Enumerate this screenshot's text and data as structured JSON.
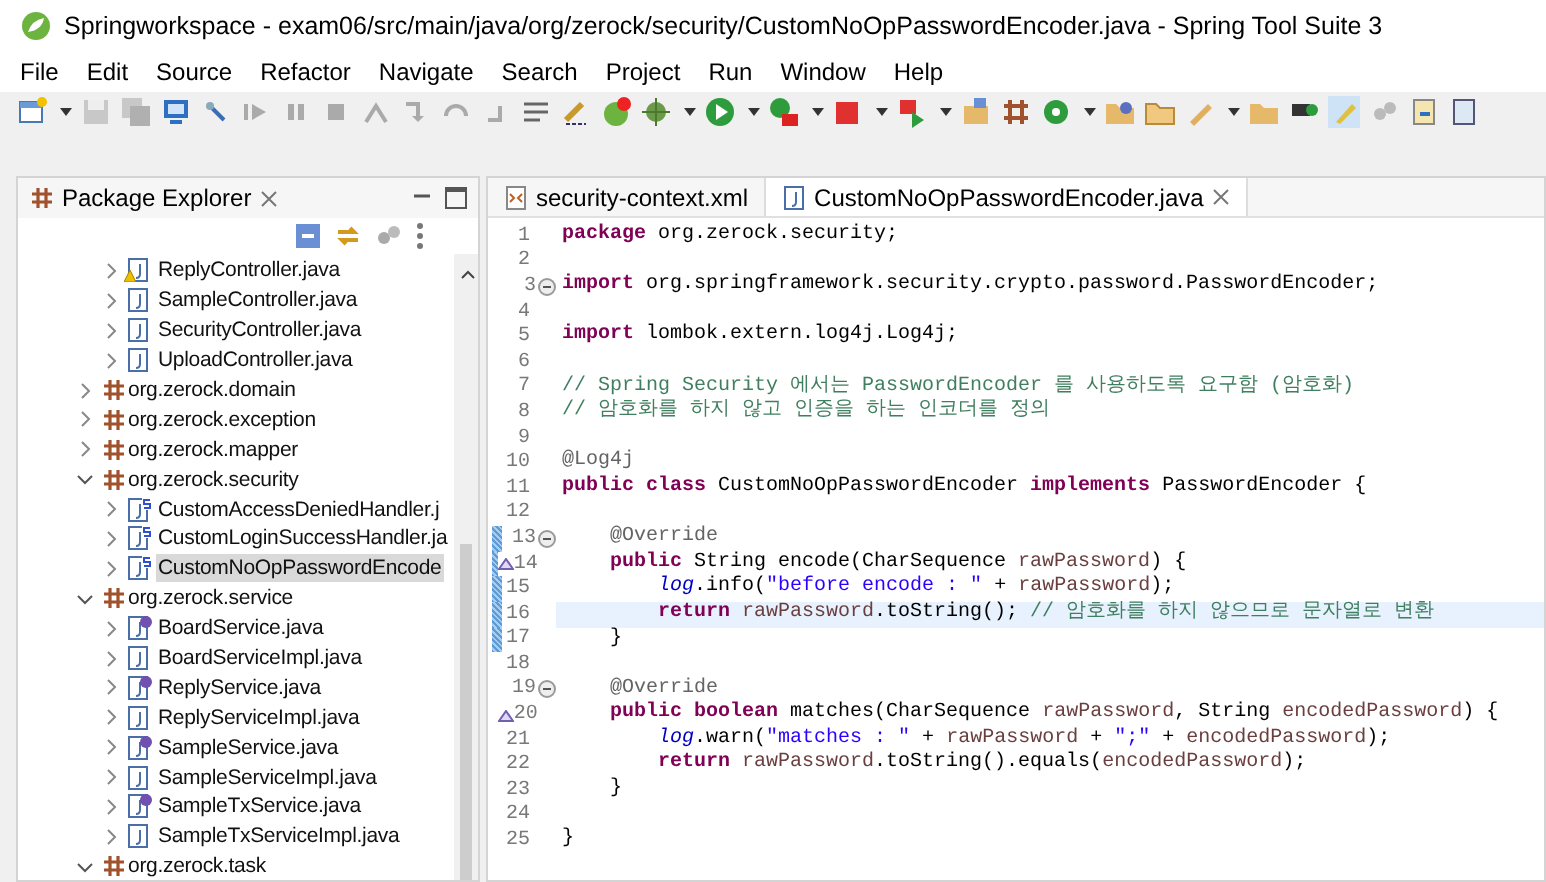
{
  "window": {
    "title": "Springworkspace - exam06/src/main/java/org/zerock/security/CustomNoOpPasswordEncoder.java - Spring Tool Suite 3"
  },
  "menu": [
    "File",
    "Edit",
    "Source",
    "Refactor",
    "Navigate",
    "Search",
    "Project",
    "Run",
    "Window",
    "Help"
  ],
  "explorer": {
    "title": "Package Explorer",
    "continued_files": [
      {
        "label": "ReplyController.java",
        "kind": "warning",
        "selected": false
      },
      {
        "label": "SampleController.java",
        "kind": "class",
        "selected": false
      },
      {
        "label": "SecurityController.java",
        "kind": "class",
        "selected": false
      },
      {
        "label": "UploadController.java",
        "kind": "class",
        "selected": false
      }
    ],
    "packages": [
      {
        "label": "org.zerock.domain",
        "expanded": false
      },
      {
        "label": "org.zerock.exception",
        "expanded": false
      },
      {
        "label": "org.zerock.mapper",
        "expanded": false
      },
      {
        "label": "org.zerock.security",
        "expanded": true,
        "children": [
          {
            "label": "CustomAccessDeniedHandler.j",
            "kind": "bean",
            "selected": false
          },
          {
            "label": "CustomLoginSuccessHandler.ja",
            "kind": "bean",
            "selected": false
          },
          {
            "label": "CustomNoOpPasswordEncode",
            "kind": "bean",
            "selected": true
          }
        ]
      },
      {
        "label": "org.zerock.service",
        "expanded": true,
        "children": [
          {
            "label": "BoardService.java",
            "kind": "interface",
            "selected": false
          },
          {
            "label": "BoardServiceImpl.java",
            "kind": "class",
            "selected": false
          },
          {
            "label": "ReplyService.java",
            "kind": "interface",
            "selected": false
          },
          {
            "label": "ReplyServiceImpl.java",
            "kind": "class",
            "selected": false
          },
          {
            "label": "SampleService.java",
            "kind": "interface",
            "selected": false
          },
          {
            "label": "SampleServiceImpl.java",
            "kind": "class",
            "selected": false
          },
          {
            "label": "SampleTxService.java",
            "kind": "interface",
            "selected": false
          },
          {
            "label": "SampleTxServiceImpl.java",
            "kind": "class",
            "selected": false
          }
        ]
      },
      {
        "label": "org.zerock.task",
        "expanded": true
      }
    ]
  },
  "editor": {
    "tabs": [
      {
        "label": "security-context.xml",
        "kind": "xml",
        "selected": false
      },
      {
        "label": "CustomNoOpPasswordEncoder.java",
        "kind": "java",
        "selected": true
      }
    ],
    "lines": [
      {
        "number": "1",
        "kind": "plain",
        "changed": false,
        "current": false,
        "tokens": [
          {
            "kind": "keyword",
            "text": "package"
          },
          {
            "kind": "plain",
            "text": " org.zerock.security;"
          }
        ]
      },
      {
        "number": "2",
        "kind": "plain",
        "changed": false,
        "current": false
      },
      {
        "number": "3",
        "kind": "fold",
        "changed": false,
        "current": false,
        "tokens": [
          {
            "kind": "keyword",
            "text": "import"
          },
          {
            "kind": "plain",
            "text": " org.springframework.security.crypto.password.PasswordEncoder;"
          }
        ]
      },
      {
        "number": "4",
        "kind": "plain",
        "changed": false,
        "current": false
      },
      {
        "number": "5",
        "kind": "plain",
        "changed": false,
        "current": false,
        "tokens": [
          {
            "kind": "keyword",
            "text": "import"
          },
          {
            "kind": "plain",
            "text": " lombok.extern.log4j.Log4j;"
          }
        ]
      },
      {
        "number": "6",
        "kind": "plain",
        "changed": false,
        "current": false
      },
      {
        "number": "7",
        "kind": "plain",
        "changed": false,
        "current": false,
        "tokens": [
          {
            "kind": "comment",
            "text": "// Spring Security 에서는 PasswordEncoder 를 사용하도록 요구함 (암호화)"
          }
        ]
      },
      {
        "number": "8",
        "kind": "plain",
        "changed": false,
        "current": false,
        "tokens": [
          {
            "kind": "comment",
            "text": "// 암호화를 하지 않고 인증을 하는 인코더를 정의"
          }
        ]
      },
      {
        "number": "9",
        "kind": "plain",
        "changed": false,
        "current": false
      },
      {
        "number": "10",
        "kind": "plain",
        "changed": false,
        "current": false,
        "tokens": [
          {
            "kind": "annotation",
            "text": "@Log4j"
          }
        ]
      },
      {
        "number": "11",
        "kind": "plain",
        "changed": false,
        "current": false,
        "tokens": [
          {
            "kind": "keyword",
            "text": "public class"
          },
          {
            "kind": "plain",
            "text": " CustomNoOpPasswordEncoder "
          },
          {
            "kind": "keyword",
            "text": "implements"
          },
          {
            "kind": "plain",
            "text": " PasswordEncoder {"
          }
        ]
      },
      {
        "number": "12",
        "kind": "plain",
        "changed": false,
        "current": false
      },
      {
        "number": "13",
        "kind": "fold",
        "changed": true,
        "current": false,
        "tokens": [
          {
            "kind": "annotation",
            "text": "    @Override"
          }
        ]
      },
      {
        "number": "14",
        "kind": "override",
        "changed": true,
        "current": false,
        "tokens": [
          {
            "kind": "keyword",
            "text": "    public"
          },
          {
            "kind": "plain",
            "text": " String encode(CharSequence "
          },
          {
            "kind": "param",
            "text": "rawPassword"
          },
          {
            "kind": "plain",
            "text": ") {"
          }
        ]
      },
      {
        "number": "15",
        "kind": "plain",
        "changed": true,
        "current": false,
        "tokens": [
          {
            "kind": "field",
            "text": "        log"
          },
          {
            "kind": "plain",
            "text": ".info("
          },
          {
            "kind": "string",
            "text": "\"before encode : \""
          },
          {
            "kind": "plain",
            "text": " + "
          },
          {
            "kind": "param",
            "text": "rawPassword"
          },
          {
            "kind": "plain",
            "text": ");"
          }
        ]
      },
      {
        "number": "16",
        "kind": "plain",
        "changed": true,
        "current": true,
        "tokens": [
          {
            "kind": "keyword",
            "text": "        return"
          },
          {
            "kind": "param",
            "text": " rawPassword"
          },
          {
            "kind": "plain",
            "text": ".toString(); "
          },
          {
            "kind": "comment",
            "text": "// 암호화를 하지 않으므로 문자열로 변환"
          }
        ]
      },
      {
        "number": "17",
        "kind": "plain",
        "changed": true,
        "current": false,
        "tokens": [
          {
            "kind": "plain",
            "text": "    }"
          }
        ]
      },
      {
        "number": "18",
        "kind": "plain",
        "changed": false,
        "current": false
      },
      {
        "number": "19",
        "kind": "fold",
        "changed": false,
        "current": false,
        "tokens": [
          {
            "kind": "annotation",
            "text": "    @Override"
          }
        ]
      },
      {
        "number": "20",
        "kind": "override",
        "changed": false,
        "current": false,
        "tokens": [
          {
            "kind": "keyword",
            "text": "    public boolean"
          },
          {
            "kind": "plain",
            "text": " matches(CharSequence "
          },
          {
            "kind": "param",
            "text": "rawPassword"
          },
          {
            "kind": "plain",
            "text": ", String "
          },
          {
            "kind": "param",
            "text": "encodedPassword"
          },
          {
            "kind": "plain",
            "text": ") {"
          }
        ]
      },
      {
        "number": "21",
        "kind": "plain",
        "changed": false,
        "current": false,
        "tokens": [
          {
            "kind": "field",
            "text": "        log"
          },
          {
            "kind": "plain",
            "text": ".warn("
          },
          {
            "kind": "string",
            "text": "\"matches : \""
          },
          {
            "kind": "plain",
            "text": " + "
          },
          {
            "kind": "param",
            "text": "rawPassword"
          },
          {
            "kind": "plain",
            "text": " + "
          },
          {
            "kind": "string",
            "text": "\";\""
          },
          {
            "kind": "plain",
            "text": " + "
          },
          {
            "kind": "param",
            "text": "encodedPassword"
          },
          {
            "kind": "plain",
            "text": ");"
          }
        ]
      },
      {
        "number": "22",
        "kind": "plain",
        "changed": false,
        "current": false,
        "tokens": [
          {
            "kind": "keyword",
            "text": "        return"
          },
          {
            "kind": "param",
            "text": " rawPassword"
          },
          {
            "kind": "plain",
            "text": ".toString().equals("
          },
          {
            "kind": "param",
            "text": "encodedPassword"
          },
          {
            "kind": "plain",
            "text": ");"
          }
        ]
      },
      {
        "number": "23",
        "kind": "plain",
        "changed": false,
        "current": false,
        "tokens": [
          {
            "kind": "plain",
            "text": "    }"
          }
        ]
      },
      {
        "number": "24",
        "kind": "plain",
        "changed": false,
        "current": false
      },
      {
        "number": "25",
        "kind": "plain",
        "changed": false,
        "current": false,
        "tokens": [
          {
            "kind": "plain",
            "text": "}"
          }
        ]
      }
    ]
  }
}
